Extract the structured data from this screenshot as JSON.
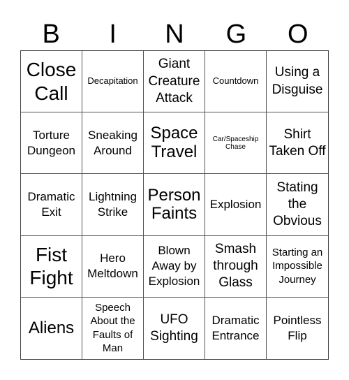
{
  "header": {
    "letters": [
      "B",
      "I",
      "N",
      "G",
      "O"
    ]
  },
  "cells": [
    "Close Call",
    "Decapitation",
    "Giant Creature Attack",
    "Countdown",
    "Using a Disguise",
    "Torture Dungeon",
    "Sneaking Around",
    "Space Travel",
    "Car/Spaceship Chase",
    "Shirt Taken Off",
    "Dramatic Exit",
    "Lightning Strike",
    "Person Faints",
    "Explosion",
    "Stating the Obvious",
    "Fist Fight",
    "Hero Meltdown",
    "Blown Away by Explosion",
    "Smash through Glass",
    "Starting an Impossible Journey",
    "Aliens",
    "Speech About the Faults of Man",
    "UFO Sighting",
    "Dramatic Entrance",
    "Pointless Flip"
  ]
}
